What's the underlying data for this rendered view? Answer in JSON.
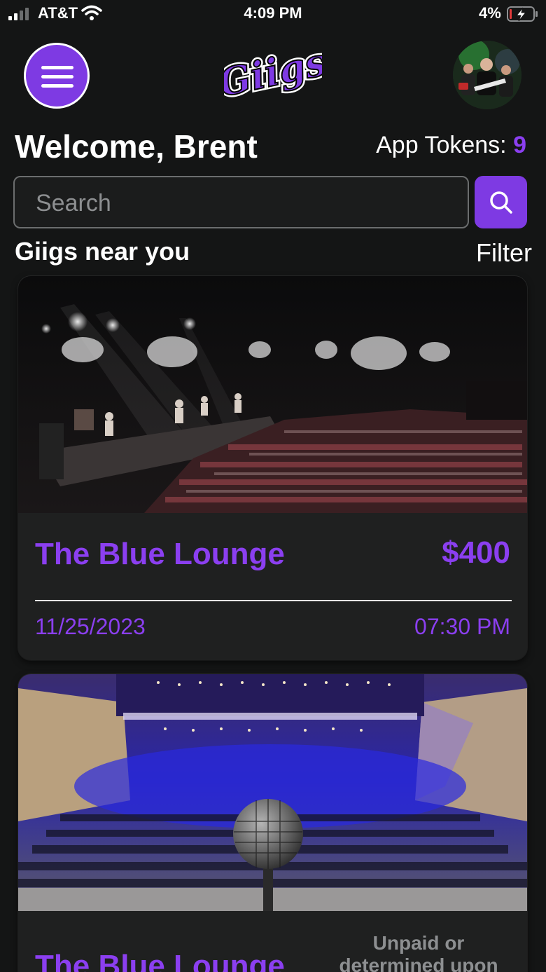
{
  "status_bar": {
    "carrier": "AT&T",
    "time": "4:09 PM",
    "battery": "4%"
  },
  "header": {
    "logo_text": "Giigs",
    "menu_icon": "hamburger-icon",
    "avatar": "profile-avatar"
  },
  "welcome": "Welcome, Brent",
  "tokens": {
    "label": "App Tokens:",
    "value": "9"
  },
  "search": {
    "placeholder": "Search",
    "value": "",
    "button_icon": "search-icon"
  },
  "section": {
    "title": "Giigs near you",
    "filter_label": "Filter"
  },
  "gigs": [
    {
      "venue": "The Blue Lounge",
      "price": "$400",
      "date": "11/25/2023",
      "time": "07:30 PM"
    },
    {
      "venue": "The Blue Lounge",
      "payment_note": "Unpaid or determined upon"
    }
  ],
  "colors": {
    "background": "#141515",
    "accent": "#7e3ae3",
    "accent_text": "#8b3ff0",
    "card": "#1f2020",
    "muted_text": "#8d8f91"
  }
}
